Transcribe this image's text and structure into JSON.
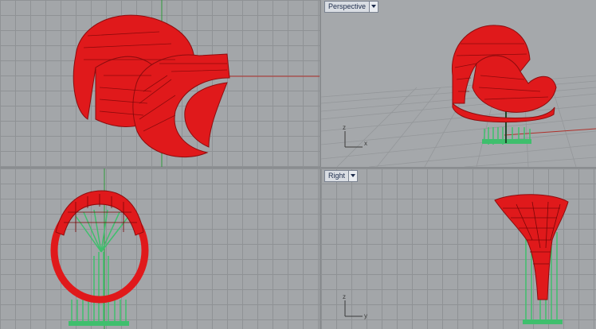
{
  "viewports": [
    {
      "id": "top",
      "label": ""
    },
    {
      "id": "perspective",
      "label": "Perspective"
    },
    {
      "id": "front",
      "label": ""
    },
    {
      "id": "right",
      "label": "Right"
    }
  ],
  "axes": {
    "perspective": {
      "up": "z",
      "right": "x"
    },
    "right": {
      "up": "z",
      "right": "y"
    }
  },
  "colors": {
    "model": "#e0191b",
    "support": "#3fbf6d",
    "grid": "#8f9295",
    "background": "#a3a6a9",
    "x_axis": "#b0302a",
    "y_axis": "#2f9a3a"
  }
}
